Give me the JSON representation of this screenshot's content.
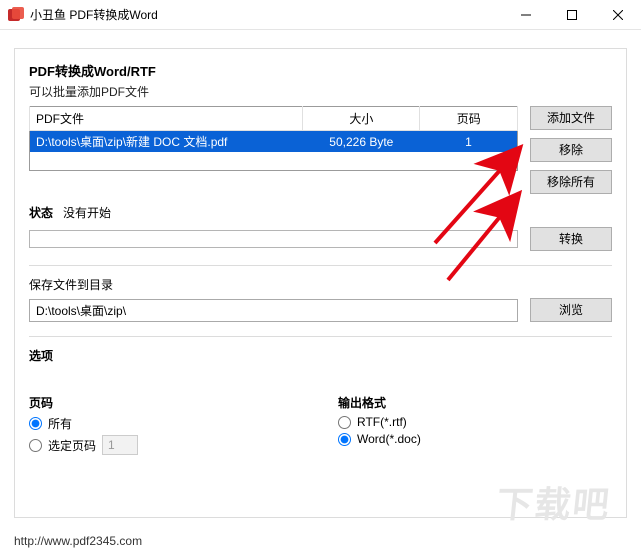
{
  "window": {
    "title": "小丑鱼 PDF转换成Word"
  },
  "section": {
    "heading": "PDF转换成Word/RTF",
    "subheading": "可以批量添加PDF文件"
  },
  "table": {
    "columns": {
      "file": "PDF文件",
      "size": "大小",
      "pages": "页码"
    },
    "rows": [
      {
        "file": "D:\\tools\\桌面\\zip\\新建 DOC 文档.pdf",
        "size": "50,226 Byte",
        "pages": "1"
      }
    ]
  },
  "buttons": {
    "add": "添加文件",
    "remove": "移除",
    "remove_all": "移除所有",
    "convert": "转换",
    "browse": "浏览"
  },
  "status": {
    "label": "状态",
    "text": "没有开始"
  },
  "save": {
    "label": "保存文件到目录",
    "path": "D:\\tools\\桌面\\zip\\"
  },
  "options": {
    "heading": "选项",
    "pages": {
      "heading": "页码",
      "all": "所有",
      "select": "选定页码",
      "select_value": "1"
    },
    "format": {
      "heading": "输出格式",
      "rtf": "RTF(*.rtf)",
      "word": "Word(*.doc)"
    }
  },
  "footer_url": "http://www.pdf2345.com",
  "watermark": "下载吧"
}
